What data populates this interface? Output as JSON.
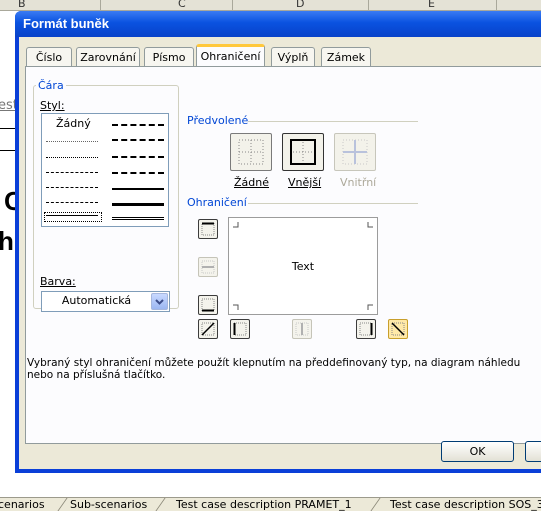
{
  "background": {
    "columns": [
      "B",
      "C",
      "D",
      "E"
    ],
    "left_fragments": [
      "est",
      "C",
      "h"
    ],
    "sheet_tabs": [
      "cenarios",
      "Sub-scenarios",
      "Test case description PRAMET_1",
      "Test case description SOS_3"
    ]
  },
  "dialog": {
    "title": "Formát buněk",
    "tabs": [
      {
        "label": "Číslo"
      },
      {
        "label": "Zarovnání"
      },
      {
        "label": "Písmo"
      },
      {
        "label": "Ohraničení",
        "selected": true
      },
      {
        "label": "Výplň"
      },
      {
        "label": "Zámek"
      }
    ],
    "line_group": {
      "title": "Čára",
      "style_label": "Styl:",
      "style_none": "Žádný",
      "color_label": "Barva:",
      "color_value": "Automatická"
    },
    "presets": {
      "title": "Předvolené",
      "buttons": [
        {
          "label": "Žádné",
          "icon": "presets-none-icon"
        },
        {
          "label": "Vnější",
          "icon": "presets-outline-icon"
        },
        {
          "label": "Vnitřní",
          "icon": "presets-inside-icon",
          "disabled": true
        }
      ]
    },
    "border": {
      "title": "Ohraničení",
      "preview_text": "Text"
    },
    "help_text": "Vybraný styl ohraničení můžete použít klepnutím na předdefinovaný typ, na diagram náhledu nebo na příslušná tlačítko.",
    "ok_label": "OK",
    "colors": {
      "title_bar": "#0a52e0",
      "accent": "#0046d5",
      "selected_tab": "#ffc83c"
    }
  }
}
